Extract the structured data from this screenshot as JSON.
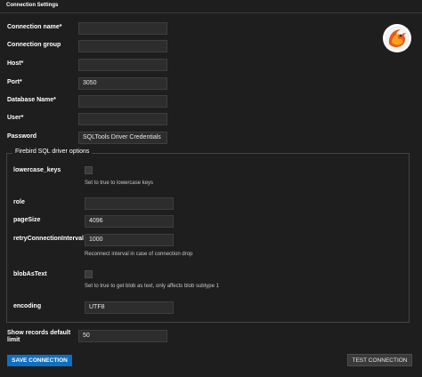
{
  "header": {
    "title": "Connection Settings"
  },
  "fields": {
    "connection_name": {
      "label": "Connection name*",
      "value": ""
    },
    "connection_group": {
      "label": "Connection group",
      "value": ""
    },
    "host": {
      "label": "Host*",
      "value": ""
    },
    "port": {
      "label": "Port*",
      "value": "3050"
    },
    "database_name": {
      "label": "Database Name*",
      "value": ""
    },
    "user": {
      "label": "User*",
      "value": ""
    },
    "password": {
      "label": "Password",
      "value": "SQLTools Driver Credentials"
    }
  },
  "driver_options": {
    "legend": "Firebird SQL driver options",
    "lowercase_keys": {
      "label": "lowercase_keys",
      "hint": "Set to true to lowercase keys"
    },
    "role": {
      "label": "role",
      "value": ""
    },
    "page_size": {
      "label": "pageSize",
      "value": "4096"
    },
    "retry_interval": {
      "label": "retryConnectionInterval",
      "value": "1000",
      "hint": "Reconnect interval in case of connection drop"
    },
    "blob_as_text": {
      "label": "blobAsText",
      "hint": "Set to true to get blob as text, only affects blob subtype 1"
    },
    "encoding": {
      "label": "encoding",
      "value": "UTF8"
    }
  },
  "records_limit": {
    "label_line1": "Show records default",
    "label_line2": "limit",
    "value": "50"
  },
  "buttons": {
    "save": "SAVE CONNECTION",
    "test": "TEST CONNECTION"
  },
  "colors": {
    "accent": "#0e70c0",
    "background": "#1e1e1e",
    "input_bg": "#2d2d2d"
  },
  "logo": {
    "icon": "firebird-logo-icon"
  }
}
